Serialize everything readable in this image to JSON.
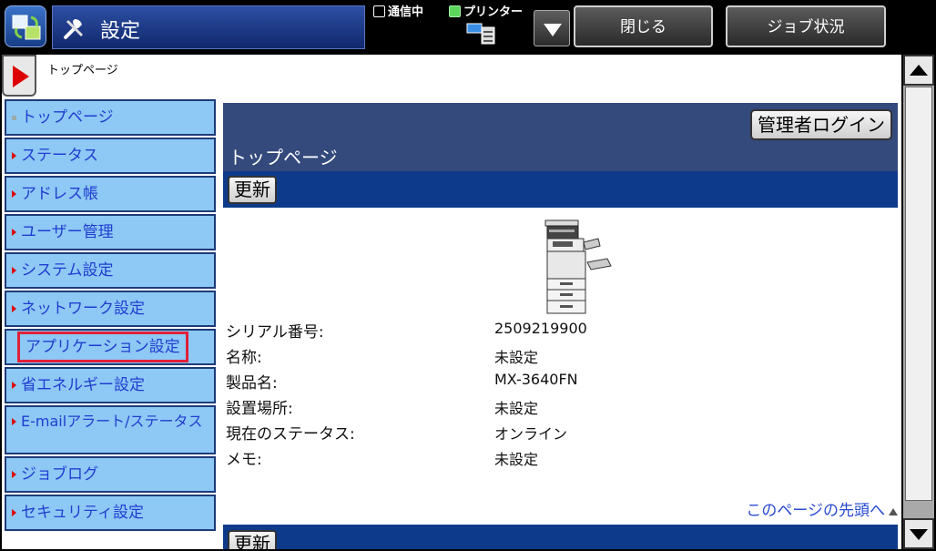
{
  "header": {
    "title": "設定",
    "status_comm": "通信中",
    "status_printer": "プリンター",
    "close_label": "閉じる",
    "job_status_label": "ジョブ状況"
  },
  "breadcrumb": {
    "text": "トップページ"
  },
  "sidebar": {
    "items": [
      {
        "label": "トップページ"
      },
      {
        "label": "ステータス"
      },
      {
        "label": "アドレス帳"
      },
      {
        "label": "ユーザー管理"
      },
      {
        "label": "システム設定"
      },
      {
        "label": "ネットワーク設定"
      },
      {
        "label": "アプリケーション設定"
      },
      {
        "label": "省エネルギー設定"
      },
      {
        "label": "E-mailアラート/ステータス"
      },
      {
        "label": "ジョブログ"
      },
      {
        "label": "セキュリティ設定"
      }
    ]
  },
  "main": {
    "admin_login_label": "管理者ログイン",
    "heading": "トップページ",
    "refresh_label": "更新",
    "info": [
      {
        "label": "シリアル番号:",
        "value": "2509219900"
      },
      {
        "label": "名称:",
        "value": "未設定"
      },
      {
        "label": "製品名:",
        "value": "MX-3640FN"
      },
      {
        "label": "設置場所:",
        "value": "未設定"
      },
      {
        "label": "現在のステータス:",
        "value": "オンライン"
      },
      {
        "label": "メモ:",
        "value": "未設定"
      }
    ],
    "page_top_link": "このページの先頭へ"
  },
  "colors": {
    "sidebar_bg": "#8ec8f5",
    "header_bg": "#34497c",
    "bar_bg": "#0d3a8a",
    "highlight": "#e0203a",
    "link": "#2a4bd0"
  }
}
